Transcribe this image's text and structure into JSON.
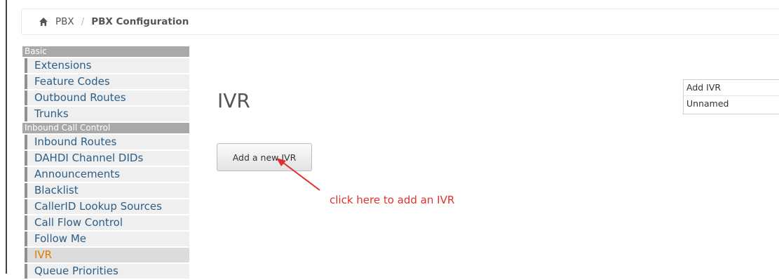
{
  "breadcrumb": {
    "home_icon": "home-icon",
    "parent": "PBX",
    "separator": "/",
    "current": "PBX Configuration"
  },
  "sidebar": {
    "sections": [
      {
        "title": "Basic",
        "items": [
          "Extensions",
          "Feature Codes",
          "Outbound Routes",
          "Trunks"
        ]
      },
      {
        "title": "Inbound Call Control",
        "items": [
          "Inbound Routes",
          "DAHDI Channel DIDs",
          "Announcements",
          "Blacklist",
          "CallerID Lookup Sources",
          "Call Flow Control",
          "Follow Me",
          "IVR",
          "Queue Priorities"
        ]
      }
    ],
    "active_item": "IVR"
  },
  "main": {
    "title": "IVR",
    "add_button": "Add a new IVR",
    "annotation": "click here to add an IVR"
  },
  "right_panel": {
    "items": [
      "Add IVR",
      "Unnamed"
    ]
  },
  "colors": {
    "link": "#2c5e88",
    "active": "#e07b00",
    "section_header": "#a9a9a9",
    "annotation": "#e0302e"
  }
}
